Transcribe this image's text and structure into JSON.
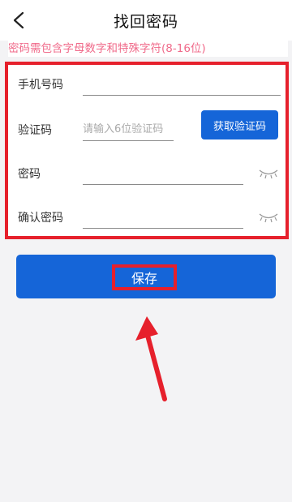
{
  "header": {
    "title": "找回密码"
  },
  "hint": "密码需包含字母数字和特殊字符(8-16位)",
  "form": {
    "phone": {
      "label": "手机号码",
      "value": "",
      "placeholder": ""
    },
    "code": {
      "label": "验证码",
      "value": "",
      "placeholder": "请输入6位验证码",
      "button": "获取验证码"
    },
    "password": {
      "label": "密码",
      "value": "",
      "placeholder": ""
    },
    "confirm": {
      "label": "确认密码",
      "value": "",
      "placeholder": ""
    }
  },
  "save_button": "保存",
  "colors": {
    "primary": "#1565d8",
    "highlight": "#e6202c",
    "hint": "#f06a8a"
  },
  "icons": [
    "back-arrow-icon",
    "eye-closed-icon"
  ]
}
